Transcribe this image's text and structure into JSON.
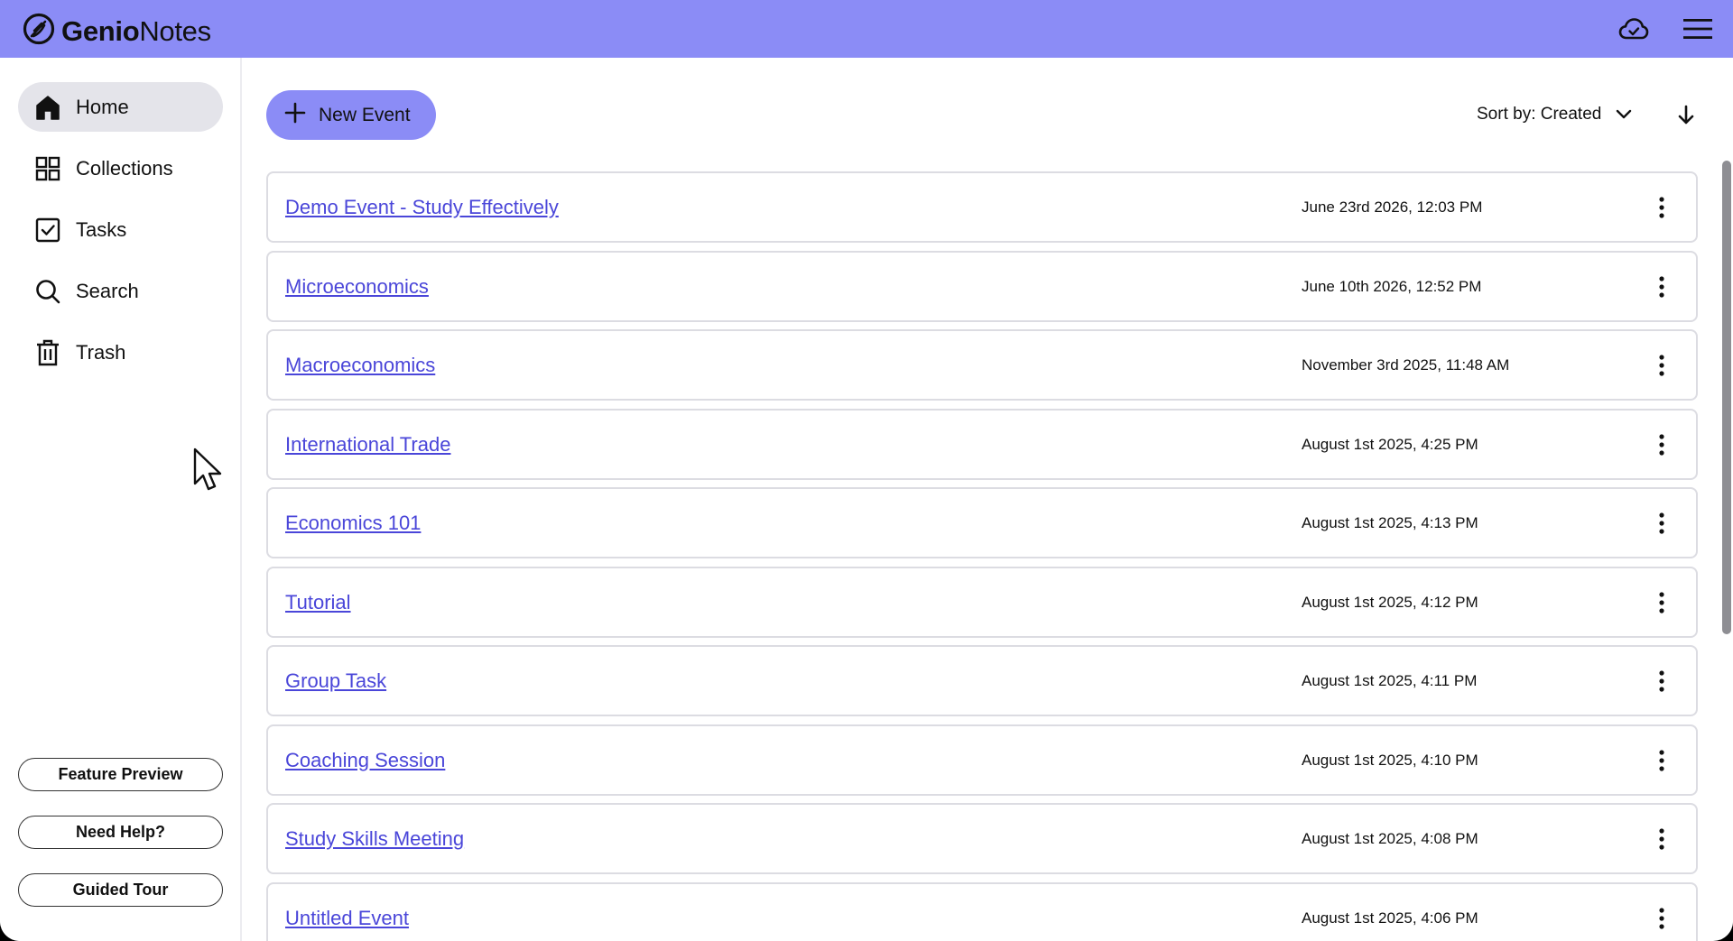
{
  "header": {
    "brand_bold": "Genio",
    "brand_light": "Notes",
    "icons": [
      "logo-icon",
      "cloud-sync-icon",
      "menu-icon"
    ]
  },
  "sidebar": {
    "items": [
      {
        "label": "Home",
        "icon": "home-icon",
        "active": true
      },
      {
        "label": "Collections",
        "icon": "grid-icon",
        "active": false
      },
      {
        "label": "Tasks",
        "icon": "checkbox-icon",
        "active": false
      },
      {
        "label": "Search",
        "icon": "search-icon",
        "active": false
      },
      {
        "label": "Trash",
        "icon": "trash-icon",
        "active": false
      }
    ],
    "buttons": {
      "feature_preview": "Feature Preview",
      "need_help": "Need Help?",
      "guided_tour": "Guided Tour"
    }
  },
  "toolbar": {
    "new_event_label": "New Event",
    "sort_label": "Sort by: Created"
  },
  "events": [
    {
      "title": "Demo Event - Study Effectively",
      "date": "June 23rd 2026, 12:03 PM"
    },
    {
      "title": "Microeconomics",
      "date": "June 10th 2026, 12:52 PM"
    },
    {
      "title": "Macroeconomics",
      "date": "November 3rd 2025, 11:48 AM"
    },
    {
      "title": "International Trade",
      "date": "August 1st 2025, 4:25 PM"
    },
    {
      "title": "Economics 101",
      "date": "August 1st 2025, 4:13 PM"
    },
    {
      "title": "Tutorial",
      "date": "August 1st 2025, 4:12 PM"
    },
    {
      "title": "Group Task",
      "date": "August 1st 2025, 4:11 PM"
    },
    {
      "title": "Coaching Session",
      "date": "August 1st 2025, 4:10 PM"
    },
    {
      "title": "Study Skills Meeting",
      "date": "August 1st 2025, 4:08 PM"
    },
    {
      "title": "Untitled Event",
      "date": "August 1st 2025, 4:06 PM"
    }
  ],
  "colors": {
    "accent": "#8b8cf6",
    "link": "#4a46d9",
    "active_nav": "#e4e4ea"
  }
}
